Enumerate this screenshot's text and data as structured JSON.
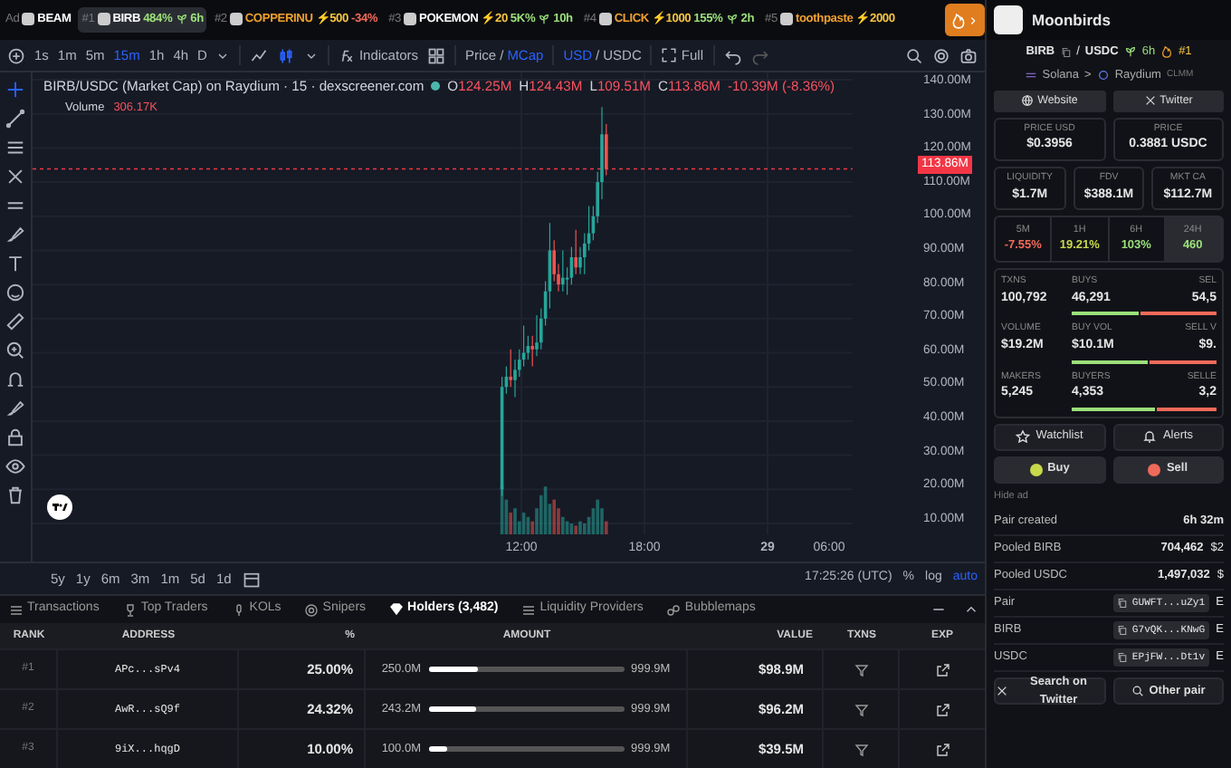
{
  "ticker": [
    {
      "rank": "Ad",
      "name": "BEAM",
      "selected": false,
      "color": "#ffffff"
    },
    {
      "rank": "#1",
      "name": "BIRB",
      "change": {
        "text": "484%",
        "color": "#9be07a"
      },
      "age": "6h",
      "selected": true,
      "color": "#ffffff"
    },
    {
      "rank": "#2",
      "name": "COPPERINU",
      "boost": "⚡500",
      "change": {
        "text": "-34%",
        "color": "#f06a5a"
      },
      "selected": false,
      "color": "#f0a030"
    },
    {
      "rank": "#3",
      "name": "POKEMON",
      "boost": "⚡20",
      "change": {
        "text": "5K%",
        "color": "#9be07a"
      },
      "age": "10h",
      "selected": false,
      "color": "#ffffff"
    },
    {
      "rank": "#4",
      "name": "CLICK",
      "boost": "⚡1000",
      "change": {
        "text": "155%",
        "color": "#9be07a"
      },
      "age": "2h",
      "selected": false,
      "color": "#f0a030"
    },
    {
      "rank": "#5",
      "name": "toothpaste",
      "boost": "⚡2000",
      "selected": false,
      "color": "#f0a030"
    }
  ],
  "toolbar": {
    "timeframes": [
      {
        "label": "1s",
        "selected": false
      },
      {
        "label": "1m",
        "selected": false
      },
      {
        "label": "5m",
        "selected": false
      },
      {
        "label": "15m",
        "selected": true
      },
      {
        "label": "1h",
        "selected": false
      },
      {
        "label": "4h",
        "selected": false
      },
      {
        "label": "D",
        "selected": false
      }
    ],
    "indicators": "Indicators",
    "toggle_separators": [
      "/",
      "/"
    ],
    "price_toggle": [
      {
        "label": "Price",
        "selected": false
      },
      {
        "label": "MCap",
        "selected": true
      }
    ],
    "currency_toggle": [
      {
        "label": "USD",
        "selected": true
      },
      {
        "label": "USDC",
        "selected": false
      }
    ],
    "full": "Full"
  },
  "chart": {
    "title": "BIRB/USDC (Market Cap) on Raydium · 15 · dexscreener.com",
    "ohlc": [
      {
        "key": "O",
        "value": "124.25M"
      },
      {
        "key": "H",
        "value": "124.43M"
      },
      {
        "key": "L",
        "value": "109.51M"
      },
      {
        "key": "C",
        "value": "113.86M"
      }
    ],
    "change": "-10.39M (-8.36%)",
    "volume_label": "Volume",
    "volume_value": "306.17K",
    "price_ticks": [
      "140.00M",
      "130.00M",
      "120.00M",
      "110.00M",
      "100.00M",
      "90.00M",
      "80.00M",
      "70.00M",
      "60.00M",
      "50.00M",
      "40.00M",
      "30.00M",
      "20.00M",
      "10.00M"
    ],
    "current_price": "113.86M",
    "time_ticks": [
      "12:00",
      "18:00",
      "29",
      "06:00"
    ],
    "ranges": [
      "5y",
      "1y",
      "6m",
      "3m",
      "1m",
      "5d",
      "1d"
    ],
    "clock": "17:25:26 (UTC)",
    "scale_options": [
      {
        "label": "%",
        "selected": false
      },
      {
        "label": "log",
        "selected": false
      },
      {
        "label": "auto",
        "selected": true
      }
    ]
  },
  "bottom_tabs": [
    {
      "label": "Transactions",
      "selected": false
    },
    {
      "label": "Top Traders",
      "selected": false
    },
    {
      "label": "KOLs",
      "selected": false
    },
    {
      "label": "Snipers",
      "selected": false
    },
    {
      "label": "Holders (3,482)",
      "selected": true
    },
    {
      "label": "Liquidity Providers",
      "selected": false
    },
    {
      "label": "Bubblemaps",
      "selected": false
    }
  ],
  "holders": {
    "columns": [
      "RANK",
      "ADDRESS",
      "%",
      "AMOUNT",
      "VALUE",
      "TXNS",
      "EXP"
    ],
    "rows": [
      {
        "rank": "#1",
        "address": "APc...sPv4",
        "percent": "25.00%",
        "amount": "250.0M",
        "level": 0.25,
        "total": "999.9M",
        "value": "$98.9M"
      },
      {
        "rank": "#2",
        "address": "AwR...sQ9f",
        "percent": "24.32%",
        "amount": "243.2M",
        "level": 0.2432,
        "total": "999.9M",
        "value": "$96.2M"
      },
      {
        "rank": "#3",
        "address": "9iX...hqgD",
        "percent": "10.00%",
        "amount": "100.0M",
        "level": 0.1,
        "total": "999.9M",
        "value": "$39.5M"
      }
    ]
  },
  "token": {
    "name": "Moonbirds",
    "base": "BIRB",
    "quote": "USDC",
    "pair_separator": "/",
    "age": "6h",
    "rank": "#1",
    "chain": "Solana",
    "breadcrumb_separator": ">",
    "dex": "Raydium",
    "dex_type": "CLMM",
    "links": [
      "Website",
      "Twitter"
    ],
    "prices": [
      {
        "label": "PRICE USD",
        "value": "$0.3956"
      },
      {
        "label": "PRICE",
        "value": "0.3881 USDC"
      }
    ],
    "metrics": [
      {
        "label": "LIQUIDITY",
        "value": "$1.7M"
      },
      {
        "label": "FDV",
        "value": "$388.1M"
      },
      {
        "label": "MKT CA",
        "value": "$112.7M"
      }
    ],
    "periods": [
      {
        "label": "5M",
        "value": "-7.55%",
        "color": "#f06a5a",
        "selected": false
      },
      {
        "label": "1H",
        "value": "19.21%",
        "color": "#c8d94a",
        "selected": false
      },
      {
        "label": "6H",
        "value": "103%",
        "color": "#9be07a",
        "selected": false
      },
      {
        "label": "24H",
        "value": "460",
        "color": "#9be07a",
        "selected": true
      }
    ],
    "stats": [
      {
        "label": "TXNS",
        "value": "100,792",
        "buy_label": "BUYS",
        "buy_value": "46,291",
        "sell_label": "SEL",
        "sell_value": "54,5",
        "level": 0.46
      },
      {
        "label": "VOLUME",
        "value": "$19.2M",
        "buy_label": "BUY VOL",
        "buy_value": "$10.1M",
        "sell_label": "SELL V",
        "sell_value": "$9.",
        "level": 0.53
      },
      {
        "label": "MAKERS",
        "value": "5,245",
        "buy_label": "BUYERS",
        "buy_value": "4,353",
        "sell_label": "SELLE",
        "sell_value": "3,2",
        "level": 0.57
      }
    ],
    "actions": [
      "Watchlist",
      "Alerts"
    ],
    "trade": [
      "Buy",
      "Sell"
    ],
    "hide_ad": "Hide ad",
    "info": [
      {
        "kind": "text",
        "label": "Pair created",
        "value": "6h 32m"
      },
      {
        "kind": "text",
        "label": "Pooled BIRB",
        "value": "704,462",
        "extra": "$2"
      },
      {
        "kind": "text",
        "label": "Pooled USDC",
        "value": "1,497,032",
        "extra": "$"
      },
      {
        "kind": "address",
        "label": "Pair",
        "value": "GUWFT...uZy1",
        "extra": "E"
      },
      {
        "kind": "address",
        "label": "BIRB",
        "value": "G7vQK...KNwG",
        "extra": "E"
      },
      {
        "kind": "address",
        "label": "USDC",
        "value": "EPjFW...Dt1v",
        "extra": "E"
      }
    ],
    "footer_buttons": [
      "Search on Twitter",
      "Other pair"
    ]
  }
}
